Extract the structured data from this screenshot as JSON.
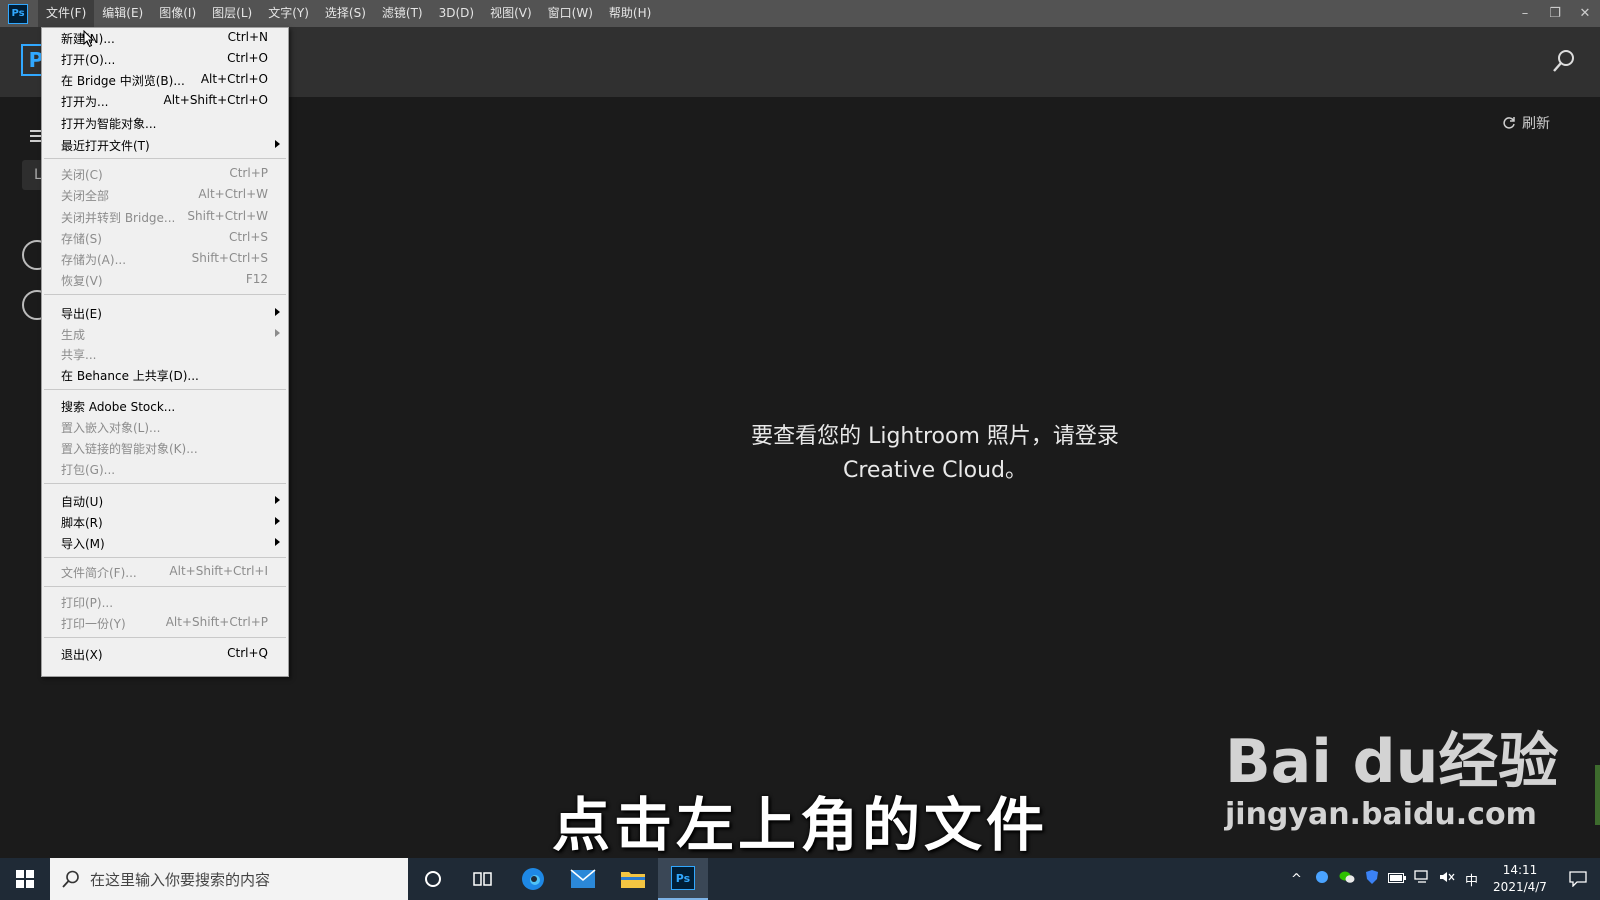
{
  "app": {
    "logo": "Ps",
    "home_logo": "P"
  },
  "menubar": {
    "items": [
      "文件(F)",
      "编辑(E)",
      "图像(I)",
      "图层(L)",
      "文字(Y)",
      "选择(S)",
      "滤镜(T)",
      "3D(D)",
      "视图(V)",
      "窗口(W)",
      "帮助(H)"
    ]
  },
  "window_controls": {
    "minimize": "–",
    "restore": "❐",
    "close": "✕"
  },
  "sidebar": {
    "tab_letter": "L"
  },
  "home": {
    "refresh_label": "刷新",
    "message_line1": "要查看您的 Lightroom 照片，请登录",
    "message_line2": "Creative Cloud。"
  },
  "file_menu": {
    "items": [
      {
        "label": "新建(N)...",
        "shortcut": "Ctrl+N",
        "enabled": true
      },
      {
        "label": "打开(O)...",
        "shortcut": "Ctrl+O",
        "enabled": true
      },
      {
        "label": "在 Bridge 中浏览(B)...",
        "shortcut": "Alt+Ctrl+O",
        "enabled": true
      },
      {
        "label": "打开为...",
        "shortcut": "Alt+Shift+Ctrl+O",
        "enabled": true
      },
      {
        "label": "打开为智能对象...",
        "shortcut": "",
        "enabled": true
      },
      {
        "label": "最近打开文件(T)",
        "shortcut": "",
        "enabled": true,
        "submenu": true
      },
      {
        "label": "关闭(C)",
        "shortcut": "Ctrl+P",
        "enabled": false
      },
      {
        "label": "关闭全部",
        "shortcut": "Alt+Ctrl+W",
        "enabled": false
      },
      {
        "label": "关闭并转到 Bridge...",
        "shortcut": "Shift+Ctrl+W",
        "enabled": false
      },
      {
        "label": "存储(S)",
        "shortcut": "Ctrl+S",
        "enabled": false
      },
      {
        "label": "存储为(A)...",
        "shortcut": "Shift+Ctrl+S",
        "enabled": false
      },
      {
        "label": "恢复(V)",
        "shortcut": "F12",
        "enabled": false
      },
      {
        "label": "导出(E)",
        "shortcut": "",
        "enabled": true,
        "submenu": true
      },
      {
        "label": "生成",
        "shortcut": "",
        "enabled": false,
        "submenu": true
      },
      {
        "label": "共享...",
        "shortcut": "",
        "enabled": false
      },
      {
        "label": "在 Behance 上共享(D)...",
        "shortcut": "",
        "enabled": true
      },
      {
        "label": "搜索 Adobe Stock...",
        "shortcut": "",
        "enabled": true
      },
      {
        "label": "置入嵌入对象(L)...",
        "shortcut": "",
        "enabled": false
      },
      {
        "label": "置入链接的智能对象(K)...",
        "shortcut": "",
        "enabled": false
      },
      {
        "label": "打包(G)...",
        "shortcut": "",
        "enabled": false
      },
      {
        "label": "自动(U)",
        "shortcut": "",
        "enabled": true,
        "submenu": true
      },
      {
        "label": "脚本(R)",
        "shortcut": "",
        "enabled": true,
        "submenu": true
      },
      {
        "label": "导入(M)",
        "shortcut": "",
        "enabled": true,
        "submenu": true
      },
      {
        "label": "文件简介(F)...",
        "shortcut": "Alt+Shift+Ctrl+I",
        "enabled": false
      },
      {
        "label": "打印(P)...",
        "shortcut": "",
        "enabled": false
      },
      {
        "label": "打印一份(Y)",
        "shortcut": "Alt+Shift+Ctrl+P",
        "enabled": false
      },
      {
        "label": "退出(X)",
        "shortcut": "Ctrl+Q",
        "enabled": true
      }
    ]
  },
  "overlay": {
    "caption": "点击左上角的文件",
    "watermark_main": "Bai du经验",
    "watermark_url": "jingyan.baidu.com"
  },
  "taskbar": {
    "search_placeholder": "在这里输入你要搜索的内容",
    "ps_label": "Ps",
    "ime": "中",
    "time": "14:11",
    "date": "2021/4/7"
  },
  "colors": {
    "ps_blue": "#31a8ff",
    "menubar": "#535353",
    "workspace": "#1b1b1b",
    "taskbar": "#1f2a36"
  }
}
